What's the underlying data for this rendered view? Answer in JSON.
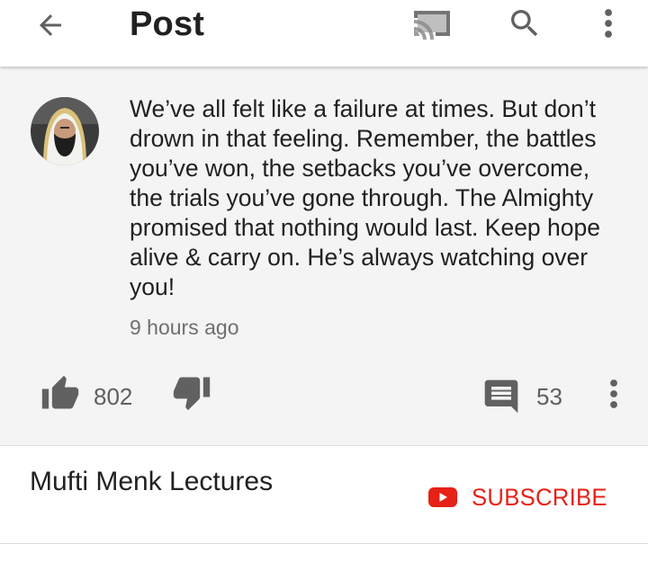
{
  "app_bar": {
    "title": "Post",
    "icons": {
      "back": "back-arrow-icon",
      "cast": "cast-icon",
      "search": "search-icon",
      "more": "more-vert-icon"
    }
  },
  "post": {
    "text": "We’ve all felt like a failure at times. But don’t drown in that feeling. Remember, the battles you’ve won, the setbacks you’ve overcome, the trials you’ve gone through. The Almighty promised that nothing would last. Keep hope alive & carry on. He’s always watching over you!",
    "time": "9 hours ago",
    "likes": "802",
    "comments": "53",
    "icons": {
      "like": "thumb-up-icon",
      "dislike": "thumb-down-icon",
      "comment": "comment-icon",
      "more": "more-vert-icon"
    }
  },
  "channel": {
    "name": "Mufti Menk Lectures",
    "subscribe_label": "SUBSCRIBE",
    "subscribe_icon": "youtube-play-icon"
  },
  "colors": {
    "icon_gray": "#616161",
    "accent_red": "#e62117",
    "card_bg": "#f4f4f4"
  }
}
